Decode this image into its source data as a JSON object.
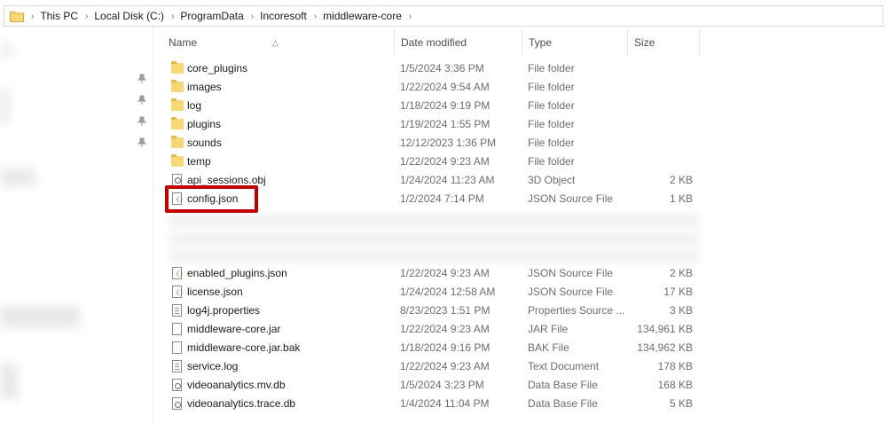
{
  "breadcrumb": [
    "This PC",
    "Local Disk (C:)",
    "ProgramData",
    "Incoresoft",
    "middleware-core"
  ],
  "columns": {
    "name": "Name",
    "date": "Date modified",
    "type": "Type",
    "size": "Size"
  },
  "files": [
    {
      "name": "core_plugins",
      "date": "1/5/2024 3:36 PM",
      "type": "File folder",
      "size": "",
      "icon": "folder-icon"
    },
    {
      "name": "images",
      "date": "1/22/2024 9:54 AM",
      "type": "File folder",
      "size": "",
      "icon": "folder-icon"
    },
    {
      "name": "log",
      "date": "1/18/2024 9:19 PM",
      "type": "File folder",
      "size": "",
      "icon": "folder-icon"
    },
    {
      "name": "plugins",
      "date": "1/19/2024 1:55 PM",
      "type": "File folder",
      "size": "",
      "icon": "folder-icon"
    },
    {
      "name": "sounds",
      "date": "12/12/2023 1:36 PM",
      "type": "File folder",
      "size": "",
      "icon": "folder-icon"
    },
    {
      "name": "temp",
      "date": "1/22/2024 9:23 AM",
      "type": "File folder",
      "size": "",
      "icon": "folder-icon"
    },
    {
      "name": "api_sessions.obj",
      "date": "1/24/2024 11:23 AM",
      "type": "3D Object",
      "size": "2 KB",
      "icon": "3d-object-icon"
    },
    {
      "name": "config.json",
      "date": "1/2/2024 7:14 PM",
      "type": "JSON Source File",
      "size": "1 KB",
      "icon": "json-file-icon"
    },
    {
      "name": "enabled_plugins.json",
      "date": "1/22/2024 9:23 AM",
      "type": "JSON Source File",
      "size": "2 KB",
      "icon": "json-file-icon"
    },
    {
      "name": "license.json",
      "date": "1/24/2024 12:58 AM",
      "type": "JSON Source File",
      "size": "17 KB",
      "icon": "json-file-icon"
    },
    {
      "name": "log4j.properties",
      "date": "8/23/2023 1:51 PM",
      "type": "Properties Source ...",
      "size": "3 KB",
      "icon": "text-file-icon"
    },
    {
      "name": "middleware-core.jar",
      "date": "1/22/2024 9:23 AM",
      "type": "JAR File",
      "size": "134,961 KB",
      "icon": "file-icon"
    },
    {
      "name": "middleware-core.jar.bak",
      "date": "1/18/2024 9:16 PM",
      "type": "BAK File",
      "size": "134,962 KB",
      "icon": "file-icon"
    },
    {
      "name": "service.log",
      "date": "1/22/2024 9:23 AM",
      "type": "Text Document",
      "size": "178 KB",
      "icon": "text-file-icon"
    },
    {
      "name": "videoanalytics.mv.db",
      "date": "1/5/2024 3:23 PM",
      "type": "Data Base File",
      "size": "168 KB",
      "icon": "database-file-icon"
    },
    {
      "name": "videoanalytics.trace.db",
      "date": "1/4/2024 11:04 PM",
      "type": "Data Base File",
      "size": "5 KB",
      "icon": "database-file-icon"
    }
  ],
  "colors": {
    "highlight": "#c00000",
    "folder": "#f8d775"
  }
}
